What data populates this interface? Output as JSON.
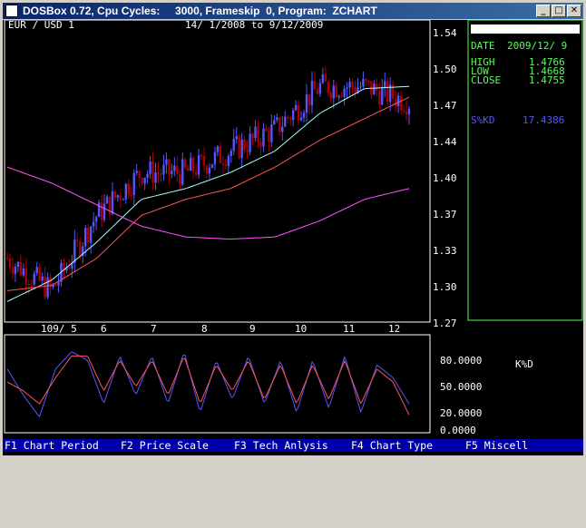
{
  "window": {
    "title": "DOSBox 0.72, Cpu Cycles:     3000, Frameskip  0, Program:  ZCHART",
    "minimize_glyph": "_",
    "maximize_glyph": "□",
    "close_glyph": "✕"
  },
  "header": {
    "pair": "EUR / USD 1",
    "date_range": "14/ 1/2008  to   9/12/2009"
  },
  "info_panel": {
    "date_label": "DATE",
    "date_value": "2009/12/ 9",
    "high_label": "HIGH",
    "high_value": "1.4766",
    "low_label": "LOW",
    "low_value": "1.4668",
    "close_label": "CLOSE",
    "close_value": "1.4755",
    "skd_label": "S%KD",
    "skd_value": "17.4386"
  },
  "stoch_label": "K%D",
  "function_keys": [
    "F1 Chart Period",
    "F2 Price Scale",
    "F3 Tech Anlysis",
    "F4 Chart Type",
    "F5 Miscell"
  ],
  "colors": {
    "screen_bg": "#000000",
    "frame": "#ffffff",
    "panel_border": "#55ff55",
    "panel_text": "#55ff55",
    "skd_text": "#5555ff",
    "candle_up": "#5555ff",
    "candle_down": "#aa0000",
    "ma_short": "#aaffff",
    "ma_mid": "#ff5555",
    "ma_long": "#ff55ff",
    "stoch_k": "#5555ff",
    "stoch_d": "#ff5555",
    "statusbar_bg": "#0000a8"
  },
  "chart_data": [
    {
      "type": "candlestick",
      "title": "EUR / USD 1",
      "subtitle": "14/ 1/2008  to   9/12/2009",
      "y_ticks": [
        "1.54",
        "1.50",
        "1.47",
        "1.44",
        "1.40",
        "1.37",
        "1.33",
        "1.30",
        "1.27"
      ],
      "x_ticks": [
        "109/ 5",
        "6",
        "7",
        "8",
        "9",
        "10",
        "11",
        "12"
      ],
      "ylim": [
        1.27,
        1.54
      ],
      "grid": false,
      "series": [
        {
          "name": "price",
          "points": [
            {
              "x": "2009-03",
              "close": 1.33
            },
            {
              "x": "2009-04",
              "close": 1.3
            },
            {
              "x": "2009-05",
              "close": 1.37
            },
            {
              "x": "2009-06",
              "close": 1.41
            },
            {
              "x": "2009-07",
              "close": 1.41
            },
            {
              "x": "2009-08",
              "close": 1.43
            },
            {
              "x": "2009-09",
              "close": 1.45
            },
            {
              "x": "2009-10",
              "close": 1.49
            },
            {
              "x": "2009-11",
              "close": 1.49
            },
            {
              "x": "2009-12",
              "close": 1.4755
            }
          ]
        },
        {
          "points": [
            1.29,
            1.31,
            1.345,
            1.385,
            1.395,
            1.41,
            1.43,
            1.465,
            1.488,
            1.49
          ]
        },
        {
          "points": [
            1.3,
            1.305,
            1.33,
            1.37,
            1.385,
            1.395,
            1.415,
            1.44,
            1.46,
            1.48
          ]
        },
        {
          "points": [
            1.415,
            1.4,
            1.38,
            1.36,
            1.35,
            1.348,
            1.35,
            1.365,
            1.385,
            1.395
          ]
        }
      ]
    },
    {
      "type": "line",
      "title": "K%D",
      "y_ticks": [
        "80.0000",
        "50.0000",
        "20.0000",
        "0.0000"
      ],
      "ylim": [
        0,
        100
      ],
      "series": [
        {
          "name": "%K",
          "values": [
            70,
            40,
            15,
            70,
            90,
            80,
            30,
            85,
            40,
            85,
            30,
            90,
            20,
            80,
            35,
            85,
            30,
            80,
            20,
            80,
            25,
            85,
            20,
            75,
            60,
            30
          ]
        },
        {
          "name": "%D",
          "values": [
            55,
            45,
            30,
            60,
            85,
            85,
            45,
            80,
            50,
            80,
            40,
            85,
            30,
            75,
            45,
            80,
            35,
            75,
            30,
            75,
            35,
            80,
            30,
            70,
            55,
            17.4386
          ]
        }
      ]
    }
  ]
}
